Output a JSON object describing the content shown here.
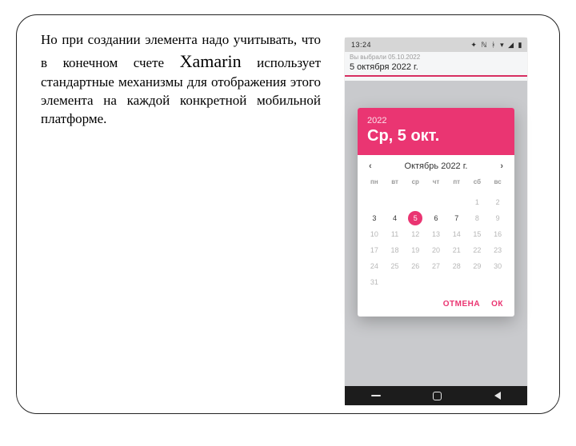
{
  "text": {
    "p1a": "Но при создании элемента надо учитывать, что в конечном счете ",
    "xamarin": "Xamarin",
    "p1b": " использует стандартные механизмы для отображения этого элемента на каждой конкретной мобильной платформе."
  },
  "phone": {
    "status_time": "13:24",
    "selected_label": "Вы выбрали 05.10.2022",
    "current_date": "5 октября 2022 г."
  },
  "dialog": {
    "year": "2022",
    "header_date": "Ср, 5 окт.",
    "month_label": "Октябрь 2022 г.",
    "dow": [
      "пн",
      "вт",
      "ср",
      "чт",
      "пт",
      "сб",
      "вс"
    ],
    "cells": [
      {
        "n": "",
        "cur": false,
        "sel": false
      },
      {
        "n": "",
        "cur": false,
        "sel": false
      },
      {
        "n": "",
        "cur": false,
        "sel": false
      },
      {
        "n": "",
        "cur": false,
        "sel": false
      },
      {
        "n": "",
        "cur": false,
        "sel": false
      },
      {
        "n": "1",
        "cur": false,
        "sel": false
      },
      {
        "n": "2",
        "cur": false,
        "sel": false
      },
      {
        "n": "3",
        "cur": true,
        "sel": false
      },
      {
        "n": "4",
        "cur": true,
        "sel": false
      },
      {
        "n": "5",
        "cur": true,
        "sel": true
      },
      {
        "n": "6",
        "cur": true,
        "sel": false
      },
      {
        "n": "7",
        "cur": true,
        "sel": false
      },
      {
        "n": "8",
        "cur": false,
        "sel": false
      },
      {
        "n": "9",
        "cur": false,
        "sel": false
      },
      {
        "n": "10",
        "cur": false,
        "sel": false
      },
      {
        "n": "11",
        "cur": false,
        "sel": false
      },
      {
        "n": "12",
        "cur": false,
        "sel": false
      },
      {
        "n": "13",
        "cur": false,
        "sel": false
      },
      {
        "n": "14",
        "cur": false,
        "sel": false
      },
      {
        "n": "15",
        "cur": false,
        "sel": false
      },
      {
        "n": "16",
        "cur": false,
        "sel": false
      },
      {
        "n": "17",
        "cur": false,
        "sel": false
      },
      {
        "n": "18",
        "cur": false,
        "sel": false
      },
      {
        "n": "19",
        "cur": false,
        "sel": false
      },
      {
        "n": "20",
        "cur": false,
        "sel": false
      },
      {
        "n": "21",
        "cur": false,
        "sel": false
      },
      {
        "n": "22",
        "cur": false,
        "sel": false
      },
      {
        "n": "23",
        "cur": false,
        "sel": false
      },
      {
        "n": "24",
        "cur": false,
        "sel": false
      },
      {
        "n": "25",
        "cur": false,
        "sel": false
      },
      {
        "n": "26",
        "cur": false,
        "sel": false
      },
      {
        "n": "27",
        "cur": false,
        "sel": false
      },
      {
        "n": "28",
        "cur": false,
        "sel": false
      },
      {
        "n": "29",
        "cur": false,
        "sel": false
      },
      {
        "n": "30",
        "cur": false,
        "sel": false
      },
      {
        "n": "31",
        "cur": false,
        "sel": false
      },
      {
        "n": "",
        "cur": false,
        "sel": false
      },
      {
        "n": "",
        "cur": false,
        "sel": false
      },
      {
        "n": "",
        "cur": false,
        "sel": false
      },
      {
        "n": "",
        "cur": false,
        "sel": false
      },
      {
        "n": "",
        "cur": false,
        "sel": false
      },
      {
        "n": "",
        "cur": false,
        "sel": false
      }
    ],
    "cancel": "ОТМЕНА",
    "ok": "ОК"
  }
}
